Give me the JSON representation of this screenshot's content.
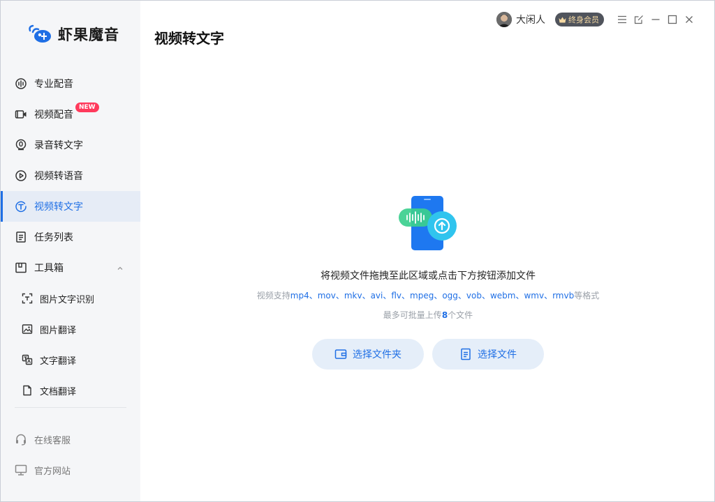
{
  "app": {
    "name": "虾果魔音"
  },
  "header": {
    "page_title": "视频转文字",
    "user_name": "大闲人",
    "vip_label": "终身会员"
  },
  "sidebar": {
    "items": [
      {
        "label": "专业配音",
        "icon": "waveform-circle-icon"
      },
      {
        "label": "视频配音",
        "icon": "video-camera-icon",
        "badge": "NEW"
      },
      {
        "label": "录音转文字",
        "icon": "microphone-icon"
      },
      {
        "label": "视频转语音",
        "icon": "play-circle-icon"
      },
      {
        "label": "视频转文字",
        "icon": "text-circle-icon",
        "active": true
      },
      {
        "label": "任务列表",
        "icon": "list-icon"
      },
      {
        "label": "工具箱",
        "icon": "toolbox-icon"
      }
    ],
    "tools": [
      {
        "label": "图片文字识别",
        "icon": "scan-text-icon"
      },
      {
        "label": "图片翻译",
        "icon": "image-icon"
      },
      {
        "label": "文字翻译",
        "icon": "translate-icon"
      },
      {
        "label": "文档翻译",
        "icon": "document-icon"
      }
    ],
    "bottom": [
      {
        "label": "在线客服",
        "icon": "headset-icon"
      },
      {
        "label": "官方网站",
        "icon": "monitor-icon"
      }
    ]
  },
  "upload": {
    "hint": "将视频文件拖拽至此区域或点击下方按钮添加文件",
    "formats_prefix": "视频支持",
    "formats": "mp4、mov、mkv、avi、flv、mpeg、ogg、vob、webm、wmv、rmvb",
    "formats_suffix": "等格式",
    "limit_prefix": "最多可批量上传",
    "limit_count": "8",
    "limit_suffix": "个文件",
    "btn_folder": "选择文件夹",
    "btn_file": "选择文件"
  },
  "colors": {
    "accent": "#1f6fe5",
    "sidebar_bg": "#f5f6f8",
    "active_bg": "#e6ecf6",
    "button_bg": "#e5eef9",
    "badge_new": "#ff3a5c"
  }
}
